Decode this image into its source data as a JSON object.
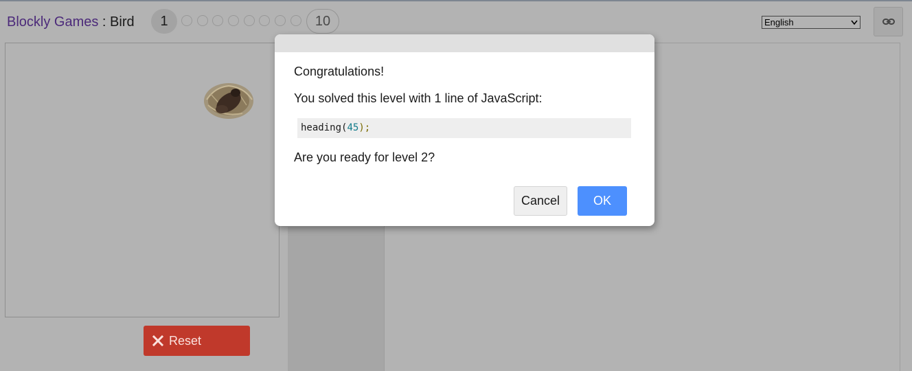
{
  "header": {
    "app_name": "Blockly Games",
    "separator": " : ",
    "game_name": "Bird"
  },
  "levels": {
    "current": "1",
    "last": "10",
    "total": 10
  },
  "language": {
    "selected": "English"
  },
  "icons": {
    "link": "link-icon",
    "reset": "close-x-icon",
    "select_caret": "chevron-down-icon"
  },
  "reset_button": {
    "label": "Reset"
  },
  "dialog": {
    "greeting": "Congratulations!",
    "message": "You solved this level with 1 line of JavaScript:",
    "code": {
      "fn": "heading",
      "open": "(",
      "arg": "45",
      "close": ");"
    },
    "question": "Are you ready for level 2?",
    "cancel_label": "Cancel",
    "ok_label": "OK"
  },
  "colors": {
    "ok_button": "#4d90fe",
    "reset_button": "#c0392b",
    "app_name": "#4c2a7a",
    "overlay": "#b3b3b3"
  }
}
